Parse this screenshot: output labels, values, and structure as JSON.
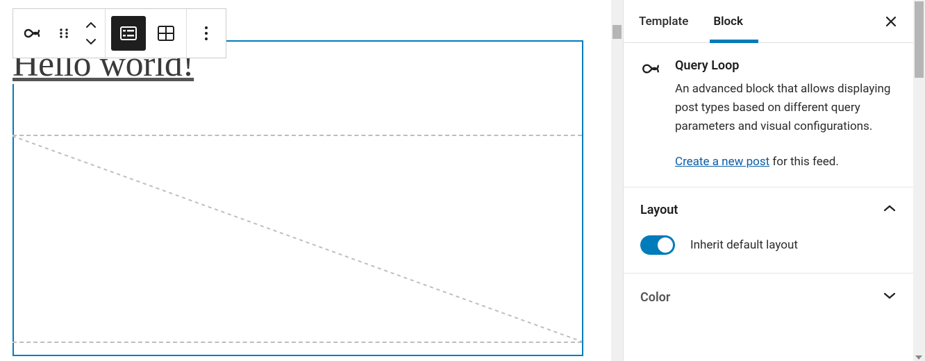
{
  "canvas": {
    "post_title": "Hello world!"
  },
  "toolbar": {
    "icons": {
      "block_type": "query-loop-icon",
      "drag": "drag-handle-icon",
      "move_up": "chevron-up-icon",
      "move_down": "chevron-down-icon",
      "list_view": "list-view-icon",
      "grid_view": "grid-view-icon",
      "more": "more-options-icon"
    }
  },
  "sidebar": {
    "tabs": [
      {
        "label": "Template",
        "active": false
      },
      {
        "label": "Block",
        "active": true
      }
    ],
    "close_label": "Close",
    "block": {
      "name": "Query Loop",
      "description": "An advanced block that allows displaying post types based on different query parameters and visual configurations.",
      "link_text": "Create a new post",
      "link_suffix": " for this feed."
    },
    "panels": {
      "layout": {
        "title": "Layout",
        "toggle_label": "Inherit default layout",
        "toggle_on": true
      },
      "color": {
        "title": "Color"
      }
    }
  }
}
